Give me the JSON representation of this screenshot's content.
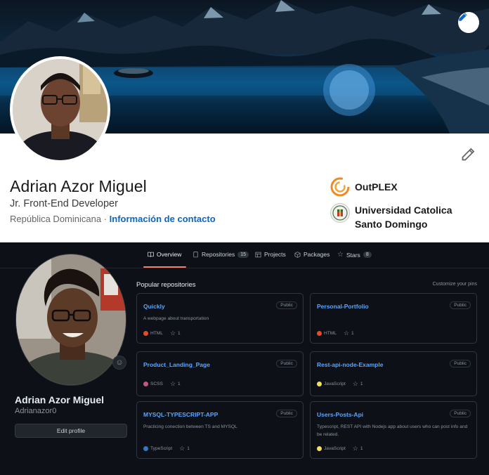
{
  "linkedin": {
    "name": "Adrian Azor Miguel",
    "headline": "Jr. Front-End Developer",
    "location": "República Dominicana",
    "separator": "·",
    "contact_link": "Información de contacto",
    "organizations": [
      {
        "name": "OutPLEX",
        "icon": "outplex-logo"
      },
      {
        "name": "Universidad Catolica Santo Domingo",
        "icon": "university-seal"
      }
    ],
    "accent": "#0a66c2"
  },
  "github": {
    "tabs": [
      {
        "label": "Overview",
        "icon": "book-icon",
        "selected": true
      },
      {
        "label": "Repositories",
        "icon": "repo-icon",
        "count": "15"
      },
      {
        "label": "Projects",
        "icon": "table-icon"
      },
      {
        "label": "Packages",
        "icon": "package-icon"
      },
      {
        "label": "Stars",
        "icon": "star-icon",
        "count": "8"
      }
    ],
    "profile": {
      "name": "Adrian Azor Miguel",
      "login": "Adrianazor0",
      "edit_label": "Edit profile",
      "status_icon": "smiley-icon"
    },
    "popular_title": "Popular repositories",
    "customize_label": "Customize your pins",
    "repos": [
      {
        "name": "Quickly",
        "visibility": "Public",
        "description": "A webpage about transportation",
        "language": "HTML",
        "lang_color": "#e34c26",
        "stars": "1"
      },
      {
        "name": "Personal-Portfolio",
        "visibility": "Public",
        "description": "",
        "language": "HTML",
        "lang_color": "#e34c26",
        "stars": "1"
      },
      {
        "name": "Product_Landing_Page",
        "visibility": "Public",
        "description": "",
        "language": "SCSS",
        "lang_color": "#c6538c",
        "stars": "1"
      },
      {
        "name": "Rest-api-node-Example",
        "visibility": "Public",
        "description": "",
        "language": "JavaScript",
        "lang_color": "#f1e05a",
        "stars": "1"
      },
      {
        "name": "MYSQL-TYPESCRIPT-APP",
        "visibility": "Public",
        "description": "Practicing conection between TS and MYSQL",
        "language": "TypeScript",
        "lang_color": "#3178c6",
        "stars": "1"
      },
      {
        "name": "Users-Posts-Api",
        "visibility": "Public",
        "description": "Typescript, REST API with Nodejs app about users who can post info and be related.",
        "language": "JavaScript",
        "lang_color": "#f1e05a",
        "stars": "1"
      }
    ]
  }
}
